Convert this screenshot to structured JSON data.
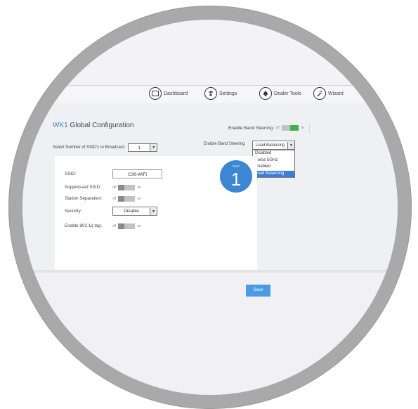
{
  "nav": {
    "dashboard": "Dashboard",
    "settings": "Settings",
    "dealer_tools": "Dealer Tools",
    "wizard": "Wizard"
  },
  "page": {
    "title_prefix": "WK1",
    "title_rest": " Global Configuration"
  },
  "band_steering_top": {
    "label": "Enable Band Steering",
    "off": "off",
    "on": "on",
    "state": "on"
  },
  "ssid_count": {
    "label": "Select Number of SSID's to Broadcast:",
    "value": "1"
  },
  "band_steering": {
    "label": "Enable Band Steering",
    "value": "Load Balancing",
    "options": [
      "Disabled",
      "Force 5GHz",
      "Enabled",
      "Load Balancing"
    ],
    "selected_index": 3
  },
  "ssid_card": {
    "ssid_label": "SSID:",
    "ssid_value": "C36-WiFi",
    "suppressed_label": "Suppressed SSID:",
    "station_label": "Station Separation:",
    "security_label": "Security:",
    "security_value": "Disable",
    "tag_label": "Enable 802.1q tag:",
    "off": "off",
    "on": "on"
  },
  "badge": {
    "caption": "SSID",
    "number": "1"
  },
  "save_label": "Save",
  "colors": {
    "accent": "#3a86c8",
    "toggle_on": "#3fb04a",
    "save": "#4a9be4",
    "selected_option": "#3b7ed8"
  }
}
